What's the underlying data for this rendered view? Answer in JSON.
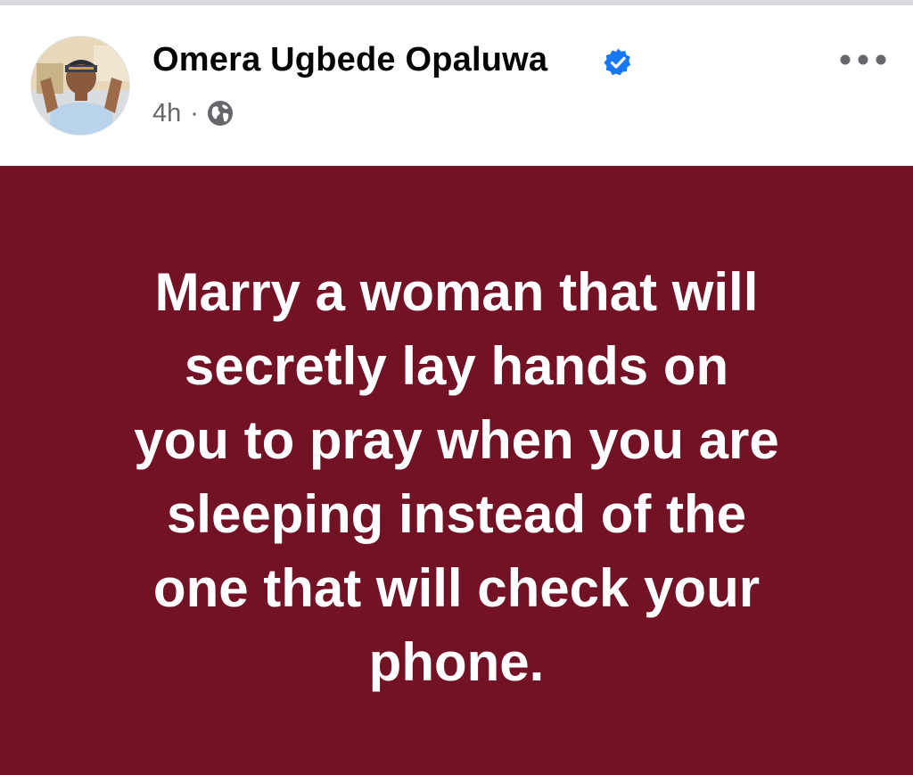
{
  "post": {
    "author": {
      "name": "Omera Ugbede Opaluwa",
      "verified": true,
      "avatar": "profile-photo"
    },
    "meta": {
      "time": "4h",
      "separator": "·",
      "audience_icon": "globe-icon"
    },
    "menu_icon": "more-horizontal-icon",
    "text_lines": [
      "Marry a woman that will",
      "secretly lay hands on",
      "you to pray when you are",
      "sleeping instead of the",
      "one that will check your",
      "phone."
    ]
  },
  "colors": {
    "post_background": "#721224",
    "post_text": "#ffffff",
    "name_text": "#050505",
    "meta_text": "#65676b",
    "verified_badge": "#1877f2"
  }
}
